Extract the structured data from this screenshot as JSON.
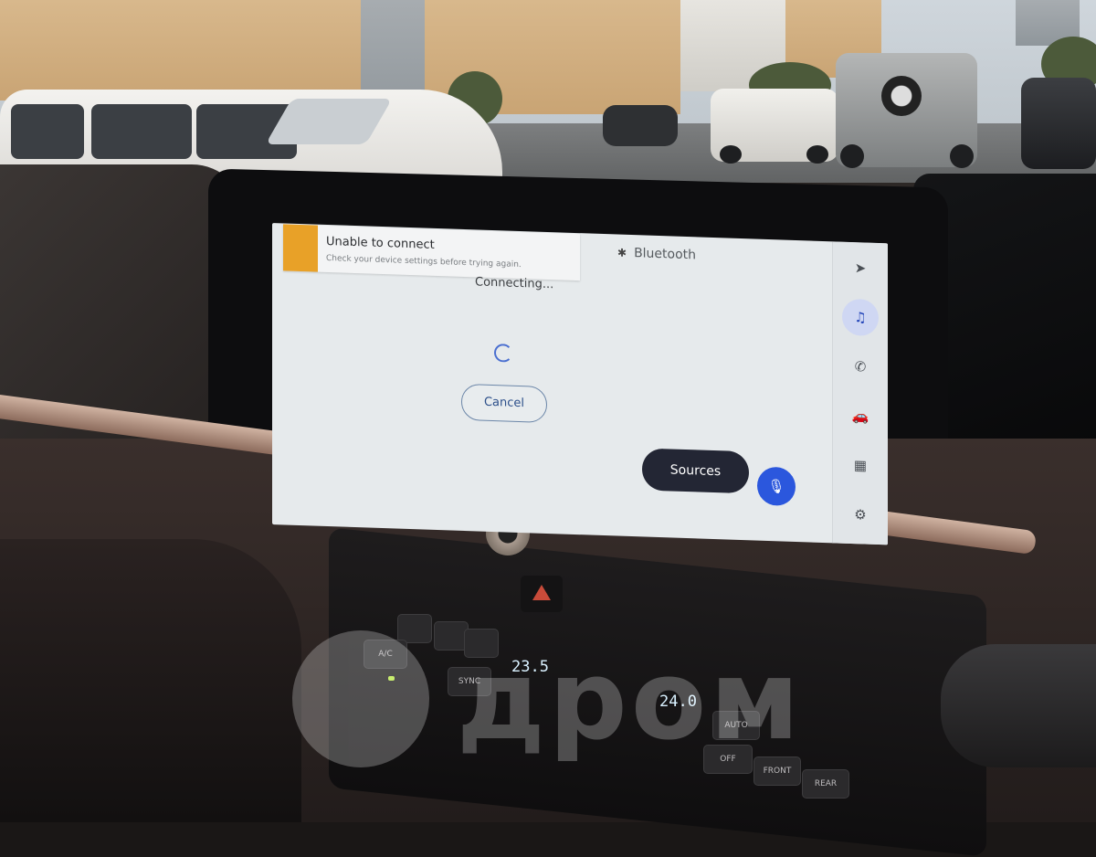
{
  "notification": {
    "title": "Unable to connect",
    "message": "Check your device settings before trying again.",
    "icon": "bluetooth-icon",
    "accent_color": "#e8a128"
  },
  "header": {
    "title": "Bluetooth",
    "icon": "bluetooth-icon"
  },
  "status": {
    "text": "Connecting..."
  },
  "buttons": {
    "cancel": "Cancel",
    "sources": "Sources",
    "voice_icon": "microphone-icon",
    "voice_color": "#2b57dd"
  },
  "rail": {
    "items": [
      {
        "icon": "navigation-icon",
        "active": false
      },
      {
        "icon": "music-icon",
        "active": true
      },
      {
        "icon": "phone-icon",
        "active": false
      },
      {
        "icon": "car-icon",
        "active": false
      },
      {
        "icon": "apps-grid-icon",
        "active": false
      },
      {
        "icon": "settings-gear-icon",
        "active": false
      }
    ]
  },
  "climate": {
    "left_temp": "23.5",
    "right_temp": "24.0",
    "labels": {
      "ac": "A/C",
      "sync": "SYNC",
      "auto": "AUTO",
      "off": "OFF",
      "front": "FRONT",
      "rear": "REAR"
    }
  },
  "watermark": {
    "text": "дром"
  }
}
